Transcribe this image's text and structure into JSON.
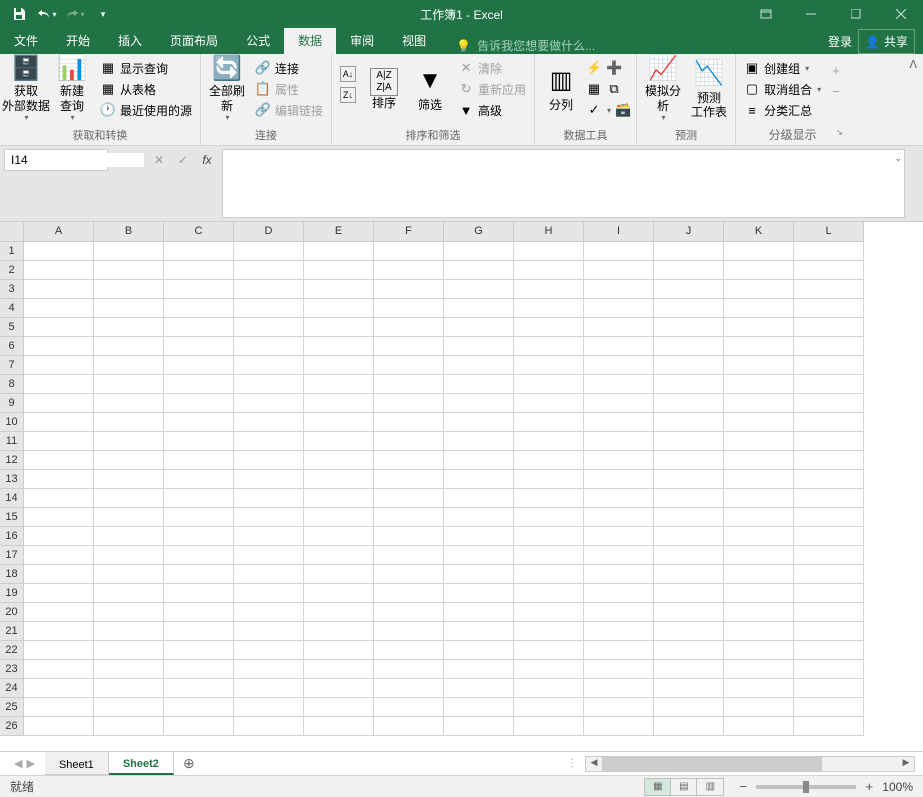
{
  "title": "工作簿1 - Excel",
  "menu": {
    "file": "文件",
    "home": "开始",
    "insert": "插入",
    "layout": "页面布局",
    "formula": "公式",
    "data": "数据",
    "review": "审阅",
    "view": "视图",
    "tellme": "告诉我您想要做什么...",
    "login": "登录",
    "share": "共享"
  },
  "ribbon": {
    "g1": {
      "label": "获取和转换",
      "ext": "获取\n外部数据",
      "newq": "新建\n查询",
      "showq": "显示查询",
      "fromtbl": "从表格",
      "recent": "最近使用的源"
    },
    "g2": {
      "label": "连接",
      "refresh": "全部刷新",
      "conn": "连接",
      "prop": "属性",
      "edit": "编辑链接"
    },
    "g3": {
      "label": "排序和筛选",
      "sort": "排序",
      "filter": "筛选",
      "clear": "清除",
      "reapply": "重新应用",
      "adv": "高级"
    },
    "g4": {
      "label": "数据工具",
      "split": "分列"
    },
    "g5": {
      "label": "预测",
      "whatif": "模拟分析",
      "forecast": "预测\n工作表"
    },
    "g6": {
      "label": "分级显示",
      "group": "创建组",
      "ungroup": "取消组合",
      "subtotal": "分类汇总"
    }
  },
  "namebox": "I14",
  "fx_label": "fx",
  "columns": [
    "A",
    "B",
    "C",
    "D",
    "E",
    "F",
    "G",
    "H",
    "I",
    "J",
    "K",
    "L"
  ],
  "rows": [
    "1",
    "2",
    "3",
    "4",
    "5",
    "6",
    "7",
    "8",
    "9",
    "10",
    "11",
    "12",
    "13",
    "14",
    "15",
    "16",
    "17",
    "18",
    "19",
    "20",
    "21",
    "22",
    "23",
    "24",
    "25",
    "26"
  ],
  "sheets": {
    "s1": "Sheet1",
    "s2": "Sheet2"
  },
  "status": {
    "ready": "就绪",
    "zoom": "100%"
  }
}
